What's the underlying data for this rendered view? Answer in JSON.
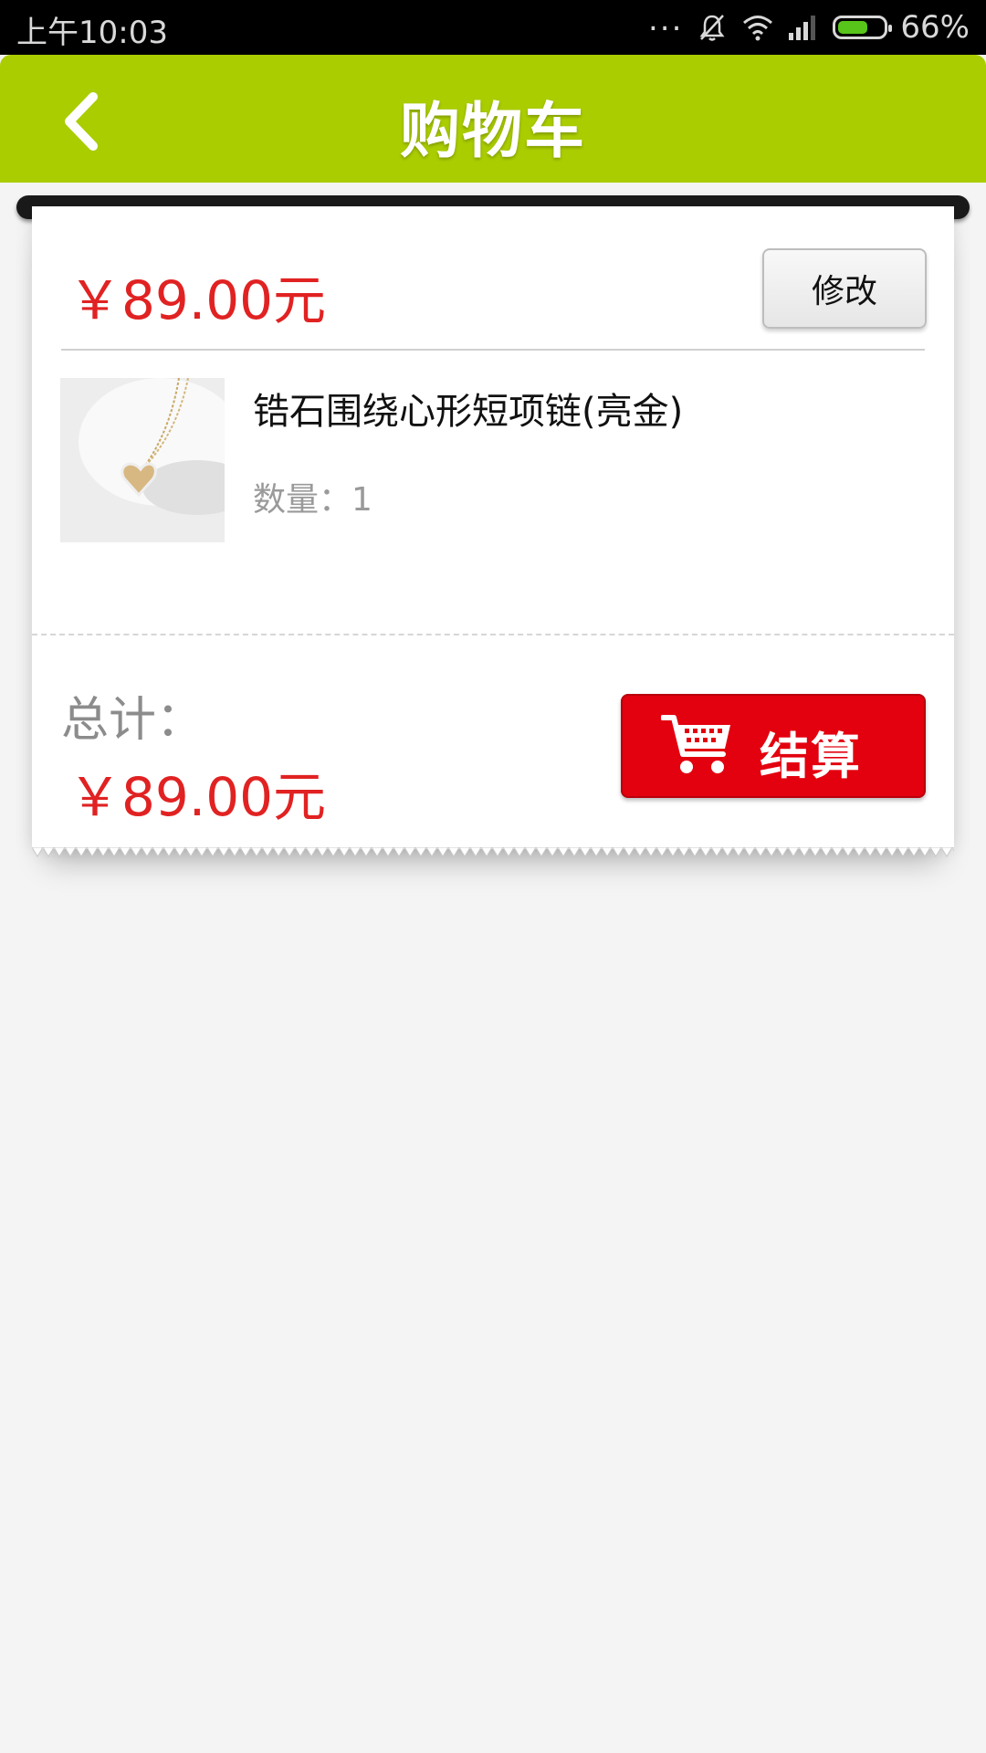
{
  "status_bar": {
    "time": "上午10:03",
    "dots": "...",
    "battery_percent": "66%",
    "battery_level": 0.66,
    "icons": [
      "mute-icon",
      "wifi-icon",
      "signal-icon",
      "battery-icon"
    ]
  },
  "header": {
    "title": "购物车",
    "back_icon": "chevron-left-icon",
    "color": "#aacd00"
  },
  "cart": {
    "subtotal": "￥89.00元",
    "edit_label": "修改",
    "item": {
      "name": "锆石围绕心形短项链(亮金)",
      "quantity": "数量：1",
      "image": "heart-necklace-image"
    },
    "total_label": "总计：",
    "total_value": "￥89.00元",
    "checkout_label": "结算",
    "checkout_icon": "shopping-cart-icon",
    "accent": "#e3000f",
    "price_color": "#e12222"
  }
}
